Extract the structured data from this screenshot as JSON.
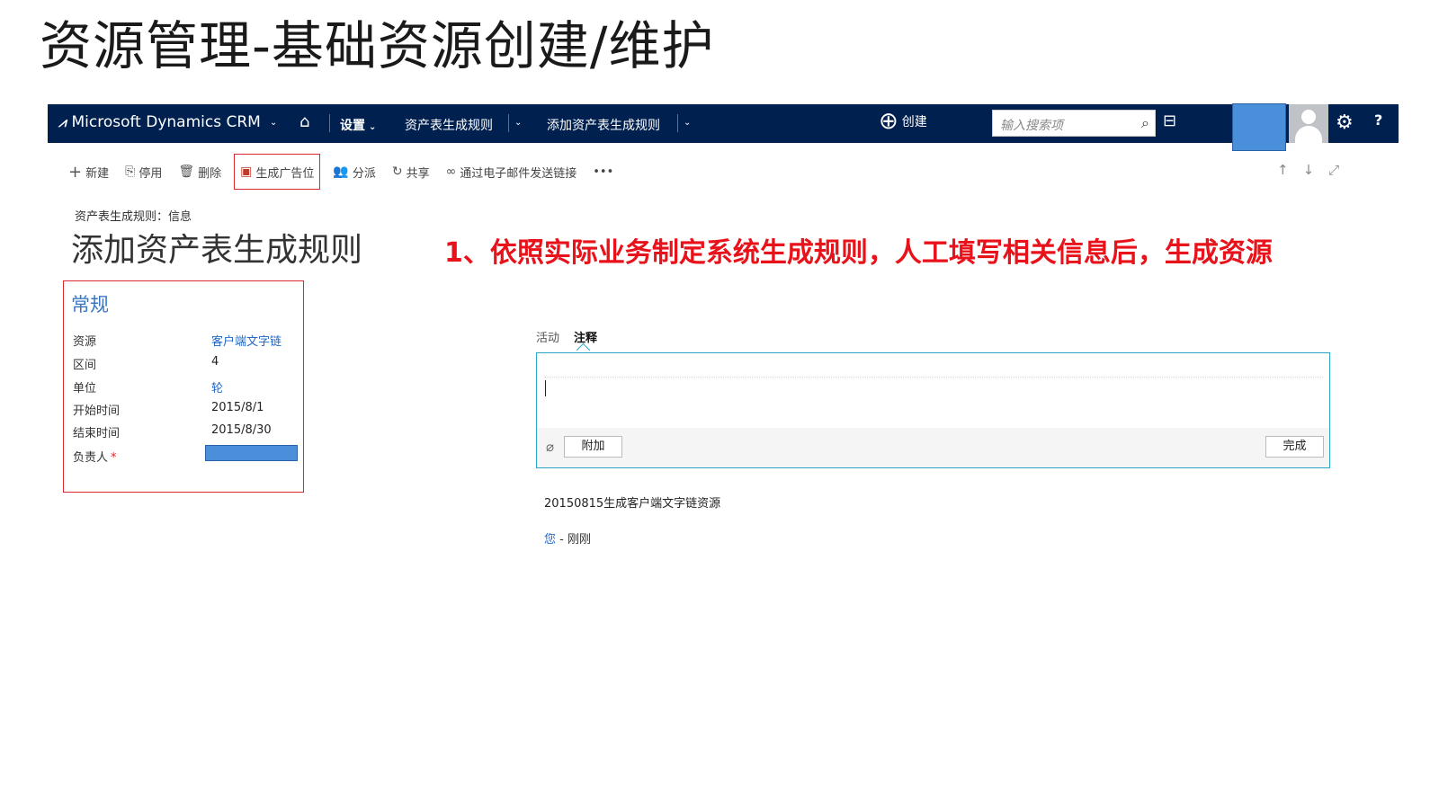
{
  "slide": {
    "title": "资源管理-基础资源创建/维护"
  },
  "nav": {
    "brand": "Microsoft Dynamics CRM",
    "items": [
      "设置",
      "资产表生成规则",
      "添加资产表生成规则"
    ],
    "create_label": "创建",
    "search_placeholder": "输入搜索项"
  },
  "toolbar": {
    "new": "新建",
    "deactivate": "停用",
    "delete": "删除",
    "generate": "生成广告位",
    "assign": "分派",
    "share": "共享",
    "email_link": "通过电子邮件发送链接",
    "more": "•••"
  },
  "form": {
    "breadcrumb": "资产表生成规则：信息",
    "title": "添加资产表生成规则"
  },
  "annotation": "1、依照实际业务制定系统生成规则，人工填写相关信息后，生成资源",
  "general": {
    "title": "常规",
    "fields": [
      {
        "label": "资源",
        "value": "客户端文字链"
      },
      {
        "label": "区间",
        "value": "4"
      },
      {
        "label": "单位",
        "value": "轮"
      },
      {
        "label": "开始时间",
        "value": "2015/8/1"
      },
      {
        "label": "结束时间",
        "value": "2015/8/30"
      },
      {
        "label": "负责人",
        "value": ""
      }
    ]
  },
  "notes": {
    "tabs": [
      "活动",
      "注释"
    ],
    "attach_label": "附加",
    "done_label": "完成",
    "text": "20150815生成客户端文字链资源",
    "author": "您",
    "separator": "-",
    "time": "刚刚"
  },
  "colors": {
    "nav_bg": "#002050",
    "accent_red": "#e8121b",
    "link_blue": "#2167c6",
    "note_border": "#2aa5c9"
  }
}
